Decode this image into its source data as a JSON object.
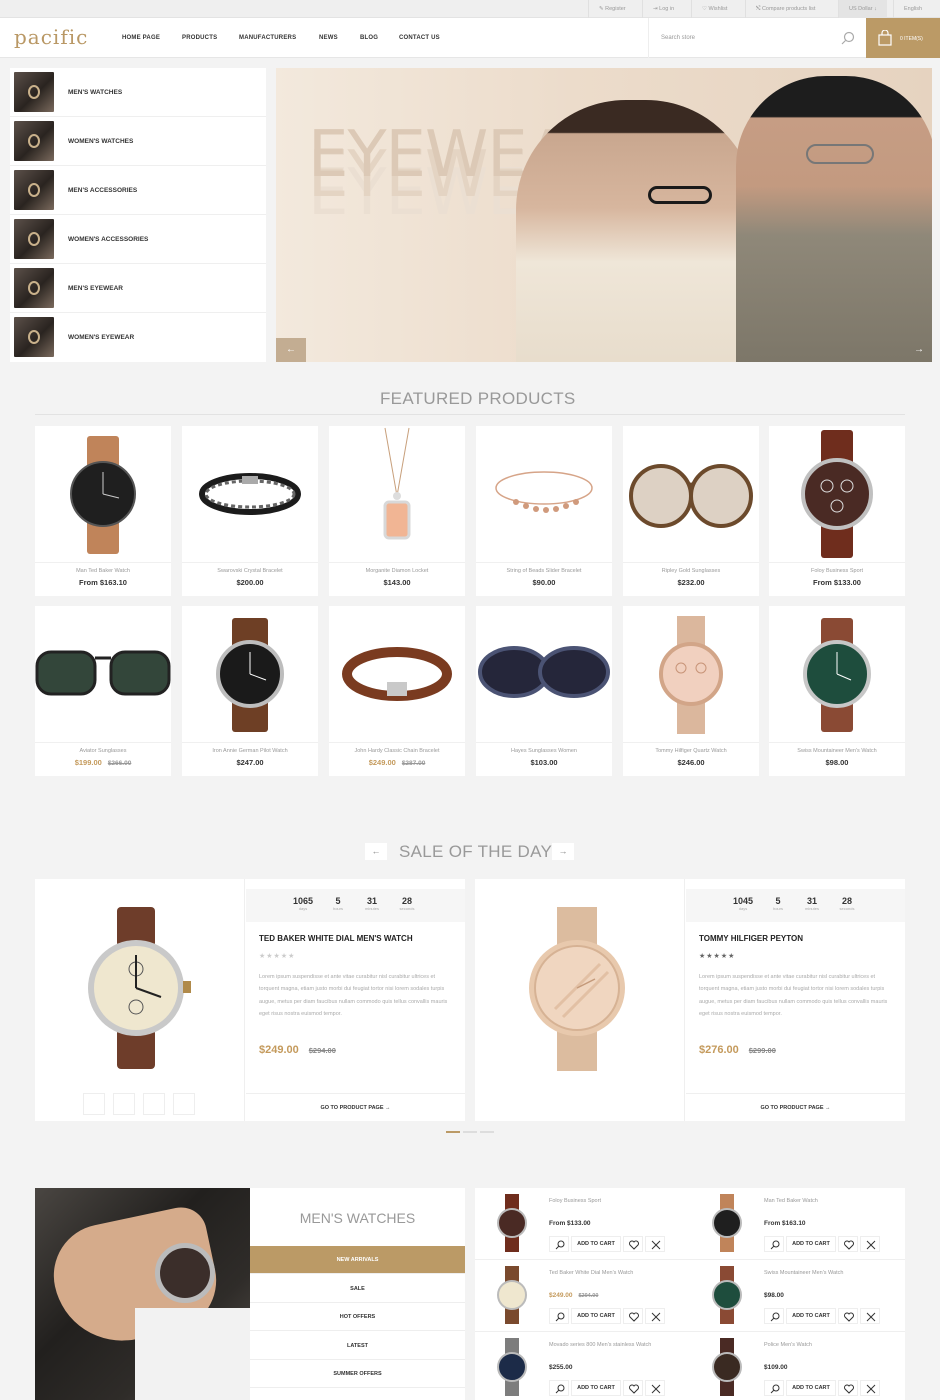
{
  "topbar": {
    "register": "Register",
    "login": "Log in",
    "wishlist": "Wishlist",
    "compare": "Compare products list",
    "currency": "US Dollar",
    "language": "English"
  },
  "header": {
    "logo": "pacific",
    "nav": [
      "HOME PAGE",
      "PRODUCTS",
      "MANUFACTURERS",
      "NEWS",
      "BLOG",
      "CONTACT US"
    ],
    "search_placeholder": "Search store",
    "cart_label": "0 ITEM(S)"
  },
  "categories": [
    "MEN'S WATCHES",
    "WOMEN'S WATCHES",
    "MEN'S ACCESSORIES",
    "WOMEN'S ACCESSORIES",
    "MEN'S EYEWEAR",
    "WOMEN'S EYEWEAR"
  ],
  "slider": {
    "headline": "EYEWEAR",
    "prev": "←",
    "next": "→"
  },
  "featured": {
    "title": "FEATURED PRODUCTS",
    "products": [
      {
        "name": "Man Ted Baker Watch",
        "price": "From $163.10",
        "old": "",
        "sale": false
      },
      {
        "name": "Swarovski Crystal Bracelet",
        "price": "$200.00",
        "old": "",
        "sale": false
      },
      {
        "name": "Morganite Diamon Locket",
        "price": "$143.00",
        "old": "",
        "sale": false
      },
      {
        "name": "String of Beads Slider Bracelet",
        "price": "$90.00",
        "old": "",
        "sale": false
      },
      {
        "name": "Ripley Gold Sunglasses",
        "price": "$232.00",
        "old": "",
        "sale": false
      },
      {
        "name": "Foloy Business Sport",
        "price": "From $133.00",
        "old": "",
        "sale": false
      },
      {
        "name": "Aviator Sunglasses",
        "price": "$199.00",
        "old": "$266.00",
        "sale": true
      },
      {
        "name": "Iron Annie German Pilot Watch",
        "price": "$247.00",
        "old": "",
        "sale": false
      },
      {
        "name": "John Hardy Classic Chain Bracelet",
        "price": "$249.00",
        "old": "$287.00",
        "sale": true
      },
      {
        "name": "Hayes Sunglasses Women",
        "price": "$103.00",
        "old": "",
        "sale": false
      },
      {
        "name": "Tommy Hilfiger Quartz Watch",
        "price": "$246.00",
        "old": "",
        "sale": false
      },
      {
        "name": "Swiss Mountaineer Men's Watch",
        "price": "$98.00",
        "old": "",
        "sale": false
      }
    ]
  },
  "sale_of_day": {
    "title": "SALE OF THE DAY",
    "prev": "←",
    "next": "→",
    "deals": [
      {
        "counter": {
          "days": "1065",
          "hours": "5",
          "minutes": "31",
          "seconds": "28"
        },
        "title": "TED BAKER WHITE DIAL MEN'S WATCH",
        "rating": 0,
        "description": "Lorem ipsum suspendisse et ante vitae curabitur nisl curabitur ultrices et torquent magna, etiam justo morbi dui feugiat tortor nisi lorem sodales turpis augue, metus per diam faucibus nullam commodo quis tellus convallis mauris eget risus nostra euismod tempor.",
        "price": "$249.00",
        "old": "$294.00",
        "link": "GO TO PRODUCT PAGE"
      },
      {
        "counter": {
          "days": "1045",
          "hours": "5",
          "minutes": "31",
          "seconds": "28"
        },
        "title": "TOMMY HILFIGER PEYTON",
        "rating": 5,
        "description": "Lorem ipsum suspendisse et ante vitae curabitur nisl curabitur ultrices et torquent magna, etiam justo morbi dui feugiat tortor nisi lorem sodales turpis augue, metus per diam faucibus nullam commodo quis tellus convallis mauris eget risus nostra euismod tempor.",
        "price": "$276.00",
        "old": "$299.00",
        "link": "GO TO PRODUCT PAGE"
      }
    ],
    "counter_units": {
      "days": "days",
      "hours": "hours",
      "minutes": "minutes",
      "seconds": "seconds"
    }
  },
  "mens_watches": {
    "title": "MEN'S WATCHES",
    "tabs": [
      "NEW ARRIVALS",
      "SALE",
      "HOT OFFERS",
      "LATEST",
      "SUMMER OFFERS"
    ],
    "active_tab": 0,
    "add_to_cart": "ADD TO CART",
    "items": [
      {
        "name": "Foloy Business Sport",
        "price": "From $133.00",
        "old": "",
        "sale": false
      },
      {
        "name": "Man Ted Baker Watch",
        "price": "From $163.10",
        "old": "",
        "sale": false
      },
      {
        "name": "Ted Baker White Dial Men's Watch",
        "price": "$249.00",
        "old": "$294.00",
        "sale": true
      },
      {
        "name": "Swiss Mountaineer Men's Watch",
        "price": "$98.00",
        "old": "",
        "sale": false
      },
      {
        "name": "Movado series 800 Men's stainless Watch",
        "price": "$255.00",
        "old": "",
        "sale": false
      },
      {
        "name": "Police Men's Watch",
        "price": "$109.00",
        "old": "",
        "sale": false
      }
    ]
  },
  "colors": {
    "accent": "#bb9a66",
    "sale": "#c49a5c",
    "bg": "#f3f3f3"
  }
}
